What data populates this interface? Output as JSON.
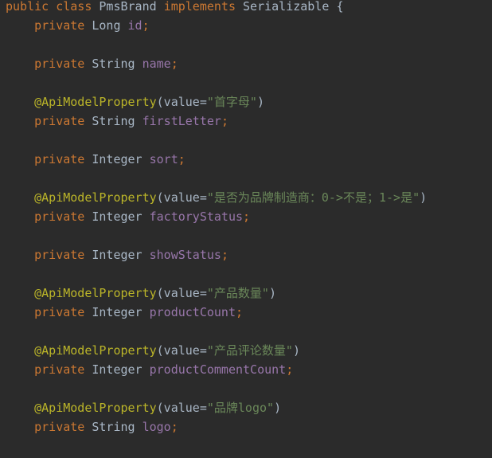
{
  "code": {
    "class_decl": {
      "kw1": "public",
      "kw2": "class",
      "name": "PmsBrand",
      "kw3": "implements",
      "iface": "Serializable",
      "brace": "{"
    },
    "fields": [
      {
        "modifier": "private",
        "type": "Long",
        "name": "id",
        "semi": ";"
      },
      {
        "modifier": "private",
        "type": "String",
        "name": "name",
        "semi": ";"
      },
      {
        "annotation": "@ApiModelProperty",
        "arg_open": "(value=",
        "arg_value": "\"首字母\"",
        "arg_close": ")",
        "modifier": "private",
        "type": "String",
        "name": "firstLetter",
        "semi": ";"
      },
      {
        "modifier": "private",
        "type": "Integer",
        "name": "sort",
        "semi": ";"
      },
      {
        "annotation": "@ApiModelProperty",
        "arg_open": "(value=",
        "arg_value": "\"是否为品牌制造商：0->不是；1->是\"",
        "arg_close": ")",
        "modifier": "private",
        "type": "Integer",
        "name": "factoryStatus",
        "semi": ";"
      },
      {
        "modifier": "private",
        "type": "Integer",
        "name": "showStatus",
        "semi": ";"
      },
      {
        "annotation": "@ApiModelProperty",
        "arg_open": "(value=",
        "arg_value": "\"产品数量\"",
        "arg_close": ")",
        "modifier": "private",
        "type": "Integer",
        "name": "productCount",
        "semi": ";"
      },
      {
        "annotation": "@ApiModelProperty",
        "arg_open": "(value=",
        "arg_value": "\"产品评论数量\"",
        "arg_close": ")",
        "modifier": "private",
        "type": "Integer",
        "name": "productCommentCount",
        "semi": ";"
      },
      {
        "annotation": "@ApiModelProperty",
        "arg_open": "(value=",
        "arg_value": "\"品牌logo\"",
        "arg_close": ")",
        "modifier": "private",
        "type": "String",
        "name": "logo",
        "semi": ";"
      }
    ]
  },
  "colors": {
    "background": "#2b2b2b",
    "keyword": "#cc7832",
    "field": "#9876aa",
    "annotation": "#bbb529",
    "string": "#6a8759",
    "plain": "#a9b7c6"
  }
}
